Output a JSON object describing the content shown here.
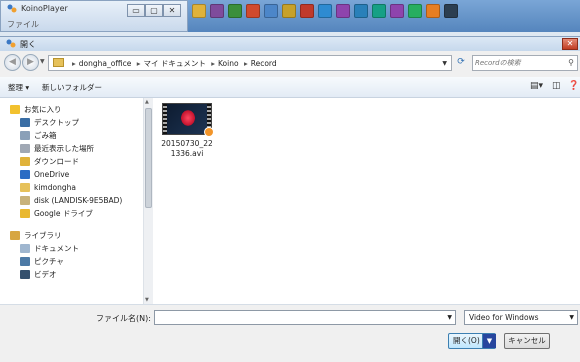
{
  "app": {
    "title": "KoinoPlayer",
    "menu_file": "ファイル",
    "window_buttons": [
      "▭",
      "▢",
      "✕"
    ],
    "toolbar_icon_colors": [
      "#e0b23a",
      "#7f4b9c",
      "#3b8f3b",
      "#d14a2e",
      "#4c86c9",
      "#c7a12a",
      "#c0392b",
      "#2e8bd1",
      "#8e44ad",
      "#2980b9",
      "#16a085",
      "#8e44ad",
      "#27ae60",
      "#e67e22",
      "#2c3e50"
    ]
  },
  "dialog": {
    "title": "開く",
    "close_label": "✕",
    "address": {
      "crumbs": [
        "dongha_office",
        "マイ ドキュメント",
        "Koino",
        "Record"
      ]
    },
    "search": {
      "placeholder": "Recordの検索"
    },
    "commands": {
      "organize": "整理 ▾",
      "new_folder": "新しいフォルダー"
    },
    "nav": {
      "items": [
        {
          "label": "お気に入り",
          "icon": "star-icon",
          "color": "#f2c12e",
          "child": false
        },
        {
          "label": "デスクトップ",
          "icon": "desktop-icon",
          "color": "#3a6ea5",
          "child": true
        },
        {
          "label": "ごみ箱",
          "icon": "recycle-bin-icon",
          "color": "#8aa0b8",
          "child": true
        },
        {
          "label": "最近表示した場所",
          "icon": "recent-places-icon",
          "color": "#a0a8b4",
          "child": true
        },
        {
          "label": "ダウンロード",
          "icon": "downloads-icon",
          "color": "#e0b23a",
          "child": true
        },
        {
          "label": "OneDrive",
          "icon": "onedrive-icon",
          "color": "#2b6cc4",
          "child": true
        },
        {
          "label": "kimdongha",
          "icon": "folder-icon",
          "color": "#e6c15a",
          "child": true
        },
        {
          "label": "disk (LANDISK-9E5BAD)",
          "icon": "network-drive-icon",
          "color": "#c8b27a",
          "child": true
        },
        {
          "label": "Google ドライブ",
          "icon": "google-drive-icon",
          "color": "#e9b830",
          "child": true
        },
        {
          "label": "ライブラリ",
          "icon": "libraries-icon",
          "color": "#d7a642",
          "child": false
        },
        {
          "label": "ドキュメント",
          "icon": "documents-icon",
          "color": "#9fb6cf",
          "child": true
        },
        {
          "label": "ピクチャ",
          "icon": "pictures-icon",
          "color": "#4d7aa6",
          "child": true
        },
        {
          "label": "ビデオ",
          "icon": "videos-icon",
          "color": "#34506e",
          "child": true
        }
      ]
    },
    "files": [
      {
        "name": "20150730_221336.avi",
        "icon": "video-file-icon"
      }
    ],
    "bottom": {
      "filename_label": "ファイル名(N):",
      "filename_value": "",
      "filetype": "Video for Windows",
      "open_label": "開く(O)",
      "cancel_label": "キャンセル"
    }
  }
}
